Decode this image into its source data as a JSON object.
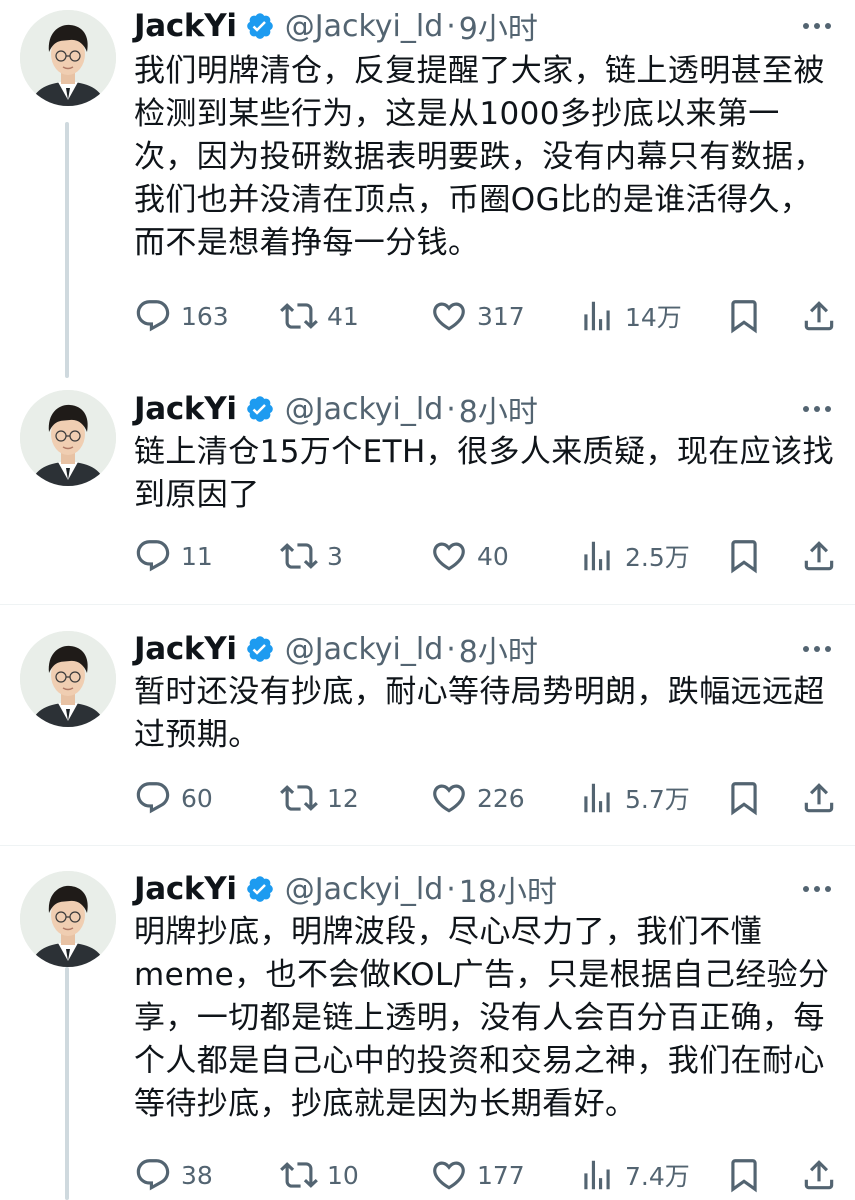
{
  "tweets": [
    {
      "name": "JackYi",
      "handle": "@Jackyi_ld",
      "separator": "·",
      "time": "9小时",
      "text": "我们明牌清仓，反复提醒了大家，链上透明甚至被检测到某些行为，这是从1000多抄底以来第一次，因为投研数据表明要跌，没有内幕只有数据，我们也并没清在顶点，币圈OG比的是谁活得久，而不是想着挣每一分钱。",
      "replies": "163",
      "retweets": "41",
      "likes": "317",
      "views": "14万"
    },
    {
      "name": "JackYi",
      "handle": "@Jackyi_ld",
      "separator": "·",
      "time": "8小时",
      "text": "链上清仓15万个ETH，很多人来质疑，现在应该找到原因了",
      "replies": "11",
      "retweets": "3",
      "likes": "40",
      "views": "2.5万"
    },
    {
      "name": "JackYi",
      "handle": "@Jackyi_ld",
      "separator": "·",
      "time": "8小时",
      "text": "暂时还没有抄底，耐心等待局势明朗，跌幅远远超过预期。",
      "replies": "60",
      "retweets": "12",
      "likes": "226",
      "views": "5.7万"
    },
    {
      "name": "JackYi",
      "handle": "@Jackyi_ld",
      "separator": "·",
      "time": "18小时",
      "text": "明牌抄底，明牌波段，尽心尽力了，我们不懂meme，也不会做KOL广告，只是根据自己经验分享，一切都是链上透明，没有人会百分百正确，每个人都是自己心中的投资和交易之神，我们在耐心等待抄底，抄底就是因为长期看好。",
      "replies": "38",
      "retweets": "10",
      "likes": "177",
      "views": "7.4万"
    }
  ],
  "colors": {
    "verified": "#1d9bf0",
    "muted": "#536471",
    "thread_line": "#cfd9de",
    "divider": "#eff3f4"
  },
  "icons": [
    "reply-icon",
    "retweet-icon",
    "like-icon",
    "views-icon",
    "bookmark-icon",
    "share-icon",
    "verified-badge-icon",
    "more-options-icon"
  ]
}
